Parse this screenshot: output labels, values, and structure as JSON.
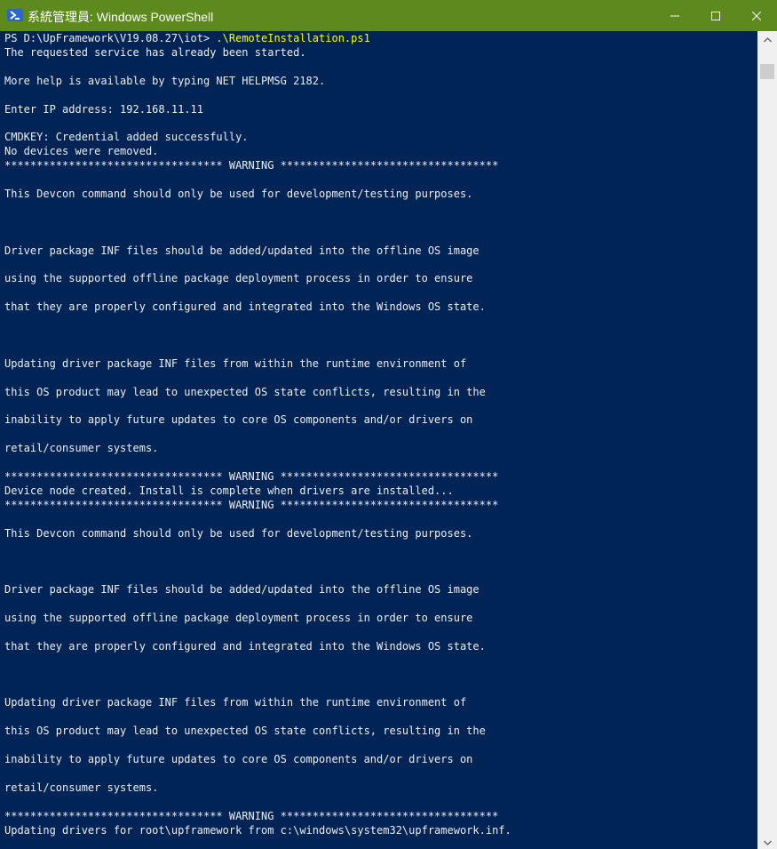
{
  "window": {
    "title": "系統管理員: Windows PowerShell",
    "titlebar_color": "#5c8a1f",
    "console_background": "#012456",
    "console_foreground": "#eeedf0",
    "command_color": "#ffff00",
    "icons": {
      "app": "powershell-icon",
      "minimize": "minimize-icon",
      "maximize": "maximize-icon",
      "close": "close-icon"
    }
  },
  "console": {
    "prompt": "PS D:\\UpFramework\\V19.08.27\\iot> ",
    "command": ".\\RemoteInstallation.ps1",
    "lines": [
      "The requested service has already been started.",
      "",
      "More help is available by typing NET HELPMSG 2182.",
      "",
      "Enter IP address: 192.168.11.11",
      "",
      "CMDKEY: Credential added successfully.",
      "No devices were removed.",
      "********************************** WARNING **********************************",
      "",
      "This Devcon command should only be used for development/testing purposes.",
      "",
      "",
      "",
      "Driver package INF files should be added/updated into the offline OS image",
      "",
      "using the supported offline package deployment process in order to ensure",
      "",
      "that they are properly configured and integrated into the Windows OS state.",
      "",
      "",
      "",
      "Updating driver package INF files from within the runtime environment of",
      "",
      "this OS product may lead to unexpected OS state conflicts, resulting in the",
      "",
      "inability to apply future updates to core OS components and/or drivers on",
      "",
      "retail/consumer systems.",
      "",
      "********************************** WARNING **********************************",
      "Device node created. Install is complete when drivers are installed...",
      "********************************** WARNING **********************************",
      "",
      "This Devcon command should only be used for development/testing purposes.",
      "",
      "",
      "",
      "Driver package INF files should be added/updated into the offline OS image",
      "",
      "using the supported offline package deployment process in order to ensure",
      "",
      "that they are properly configured and integrated into the Windows OS state.",
      "",
      "",
      "",
      "Updating driver package INF files from within the runtime environment of",
      "",
      "this OS product may lead to unexpected OS state conflicts, resulting in the",
      "",
      "inability to apply future updates to core OS components and/or drivers on",
      "",
      "retail/consumer systems.",
      "",
      "********************************** WARNING **********************************",
      "Updating drivers for root\\upframework from c:\\windows\\system32\\upframework.inf."
    ]
  },
  "scrollbar": {
    "up_icon": "chevron-up-icon",
    "down_icon": "chevron-down-icon"
  }
}
